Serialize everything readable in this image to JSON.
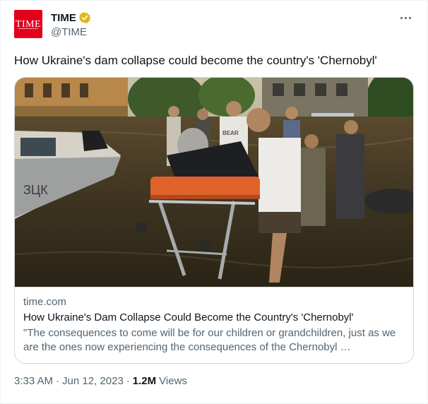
{
  "author": {
    "display_name": "TIME",
    "handle": "@TIME",
    "avatar_text": "TIME",
    "verified": true,
    "brand_color": "#e3001b",
    "verified_color": "#e2b719"
  },
  "tweet": {
    "text": "How Ukraine's dam collapse could become the country's 'Chernobyl'"
  },
  "card": {
    "domain": "time.com",
    "title": "How Ukraine's Dam Collapse Could Become the Country's 'Chernobyl'",
    "description": "\"The consequences to come will be for our children or grandchildren, just as we are the ones now experiencing the consequences of the Chernobyl …",
    "boat_text": "ЗЦК",
    "shirt_text": "BEAR"
  },
  "meta": {
    "time": "3:33 AM",
    "separator": "·",
    "date": "Jun 12, 2023",
    "views_count": "1.2M",
    "views_label": "Views"
  },
  "icons": {
    "more": "more-horizontal-icon",
    "verified": "verified-badge-icon"
  }
}
